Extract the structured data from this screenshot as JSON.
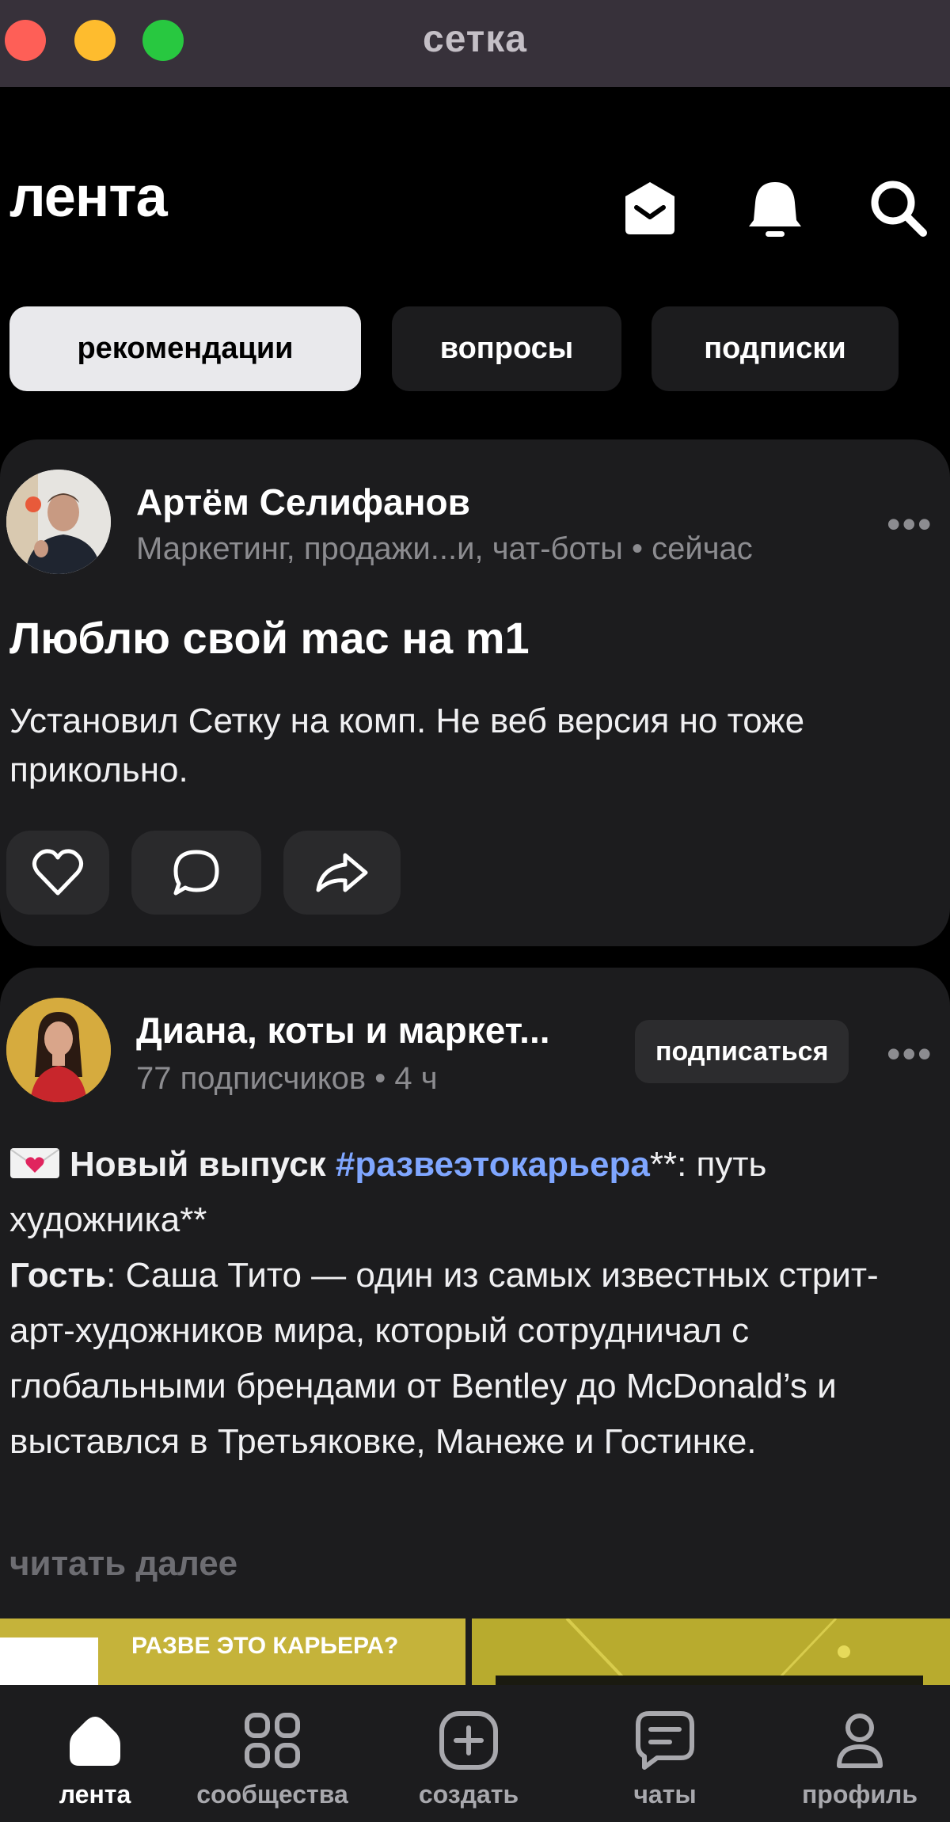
{
  "window": {
    "title": "сетка"
  },
  "header": {
    "title": "лента",
    "icons": [
      "mail-icon",
      "bell-icon",
      "search-icon"
    ]
  },
  "filters": [
    {
      "label": "рекомендации",
      "active": true
    },
    {
      "label": "вопросы",
      "active": false
    },
    {
      "label": "подписки",
      "active": false
    }
  ],
  "posts": [
    {
      "author": "Артём Селифанов",
      "meta": "Маркетинг, продажи...и, чат-боты • сейчас",
      "title": "Люблю свой mac на m1",
      "text": "Установил Сетку на комп. Не веб версия но тоже прикольно.",
      "actions": [
        "like-icon",
        "comment-icon",
        "share-icon"
      ]
    },
    {
      "author": "Диана, коты и маркет...",
      "meta": "77 подписчиков • 4 ч",
      "subscribe_label": "подписаться",
      "line1_prefix": "Новый выпуск",
      "hashtag": "#развеэтокарьера",
      "line1_suffix": "**: путь художника**",
      "guest_label": "Гость",
      "guest_text": ": Саша Тито — один из самых известных стрит-арт-художников мира, который сотрудничал с глобальными брендами от Bentley до McDonald’s и выставлся в Третьяковке, Манеже и Гостинке.",
      "read_more": "читать далее",
      "image_caption": "РАЗВЕ ЭТО КАРЬЕРА?"
    }
  ],
  "tabbar": [
    {
      "label": "лента",
      "icon": "home-icon",
      "active": true
    },
    {
      "label": "сообщества",
      "icon": "grid-icon",
      "active": false
    },
    {
      "label": "создать",
      "icon": "plus-square-icon",
      "active": false
    },
    {
      "label": "чаты",
      "icon": "chat-icon",
      "active": false
    },
    {
      "label": "профиль",
      "icon": "person-icon",
      "active": false
    }
  ],
  "colors": {
    "background": "#000000",
    "card": "#1c1c1e",
    "hashtag": "#7fa6ff",
    "titlebar": "#37313a"
  }
}
